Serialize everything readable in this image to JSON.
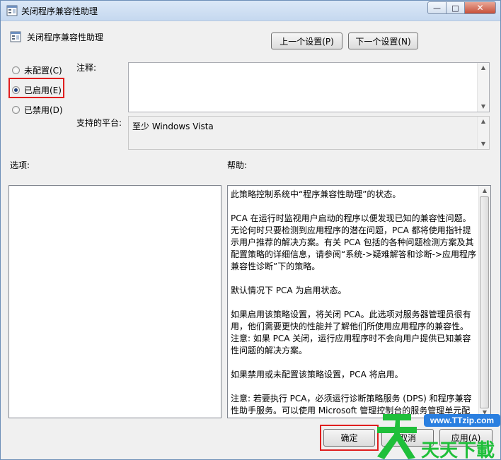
{
  "window": {
    "title": "关闭程序兼容性助理",
    "controls": {
      "minimize": "—",
      "maximize": "□",
      "close": "✕"
    }
  },
  "policy": {
    "name": "关闭程序兼容性助理",
    "prev_button": "上一个设置(P)",
    "next_button": "下一个设置(N)"
  },
  "state": {
    "options": [
      {
        "label": "未配置(C)",
        "selected": false
      },
      {
        "label": "已启用(E)",
        "selected": true
      },
      {
        "label": "已禁用(D)",
        "selected": false
      }
    ]
  },
  "comment": {
    "label": "注释:",
    "value": ""
  },
  "platform": {
    "label": "支持的平台:",
    "value": "至少 Windows Vista"
  },
  "options_panel": {
    "label": "选项:"
  },
  "help_panel": {
    "label": "帮助:",
    "paragraphs": [
      "此策略控制系统中“程序兼容性助理”的状态。",
      "PCA 在运行时监视用户启动的程序以便发现已知的兼容性问题。无论何时只要检测到应用程序的潜在问题，PCA 都将使用指针提示用户推荐的解决方案。有关 PCA 包括的各种问题检测方案及其配置策略的详细信息，请参阅“系统->疑难解答和诊断->应用程序兼容性诊断”下的策略。",
      "默认情况下 PCA 为启用状态。",
      "如果启用该策略设置，将关闭 PCA。此选项对服务器管理员很有用，他们需要更快的性能并了解他们所使用应用程序的兼容性。注意: 如果 PCA 关闭，运行应用程序时不会向用户提供已知兼容性问题的解决方案。",
      "如果禁用或未配置该策略设置，PCA 将启用。",
      "注意: 若要执行 PCA，必须运行诊断策略服务 (DPS) 和程序兼容性助手服务。可以使用 Microsoft 管理控制台的服务管理单元配置"
    ]
  },
  "footer": {
    "ok": "确定",
    "cancel": "取消",
    "apply": "应用(A)"
  },
  "watermark": {
    "site": "www.TTzip.com",
    "brand": "天天下載"
  },
  "colors": {
    "highlight": "#e01e1e",
    "watermark_green": "#1fbf3a",
    "watermark_blue": "#2a7fe0"
  }
}
